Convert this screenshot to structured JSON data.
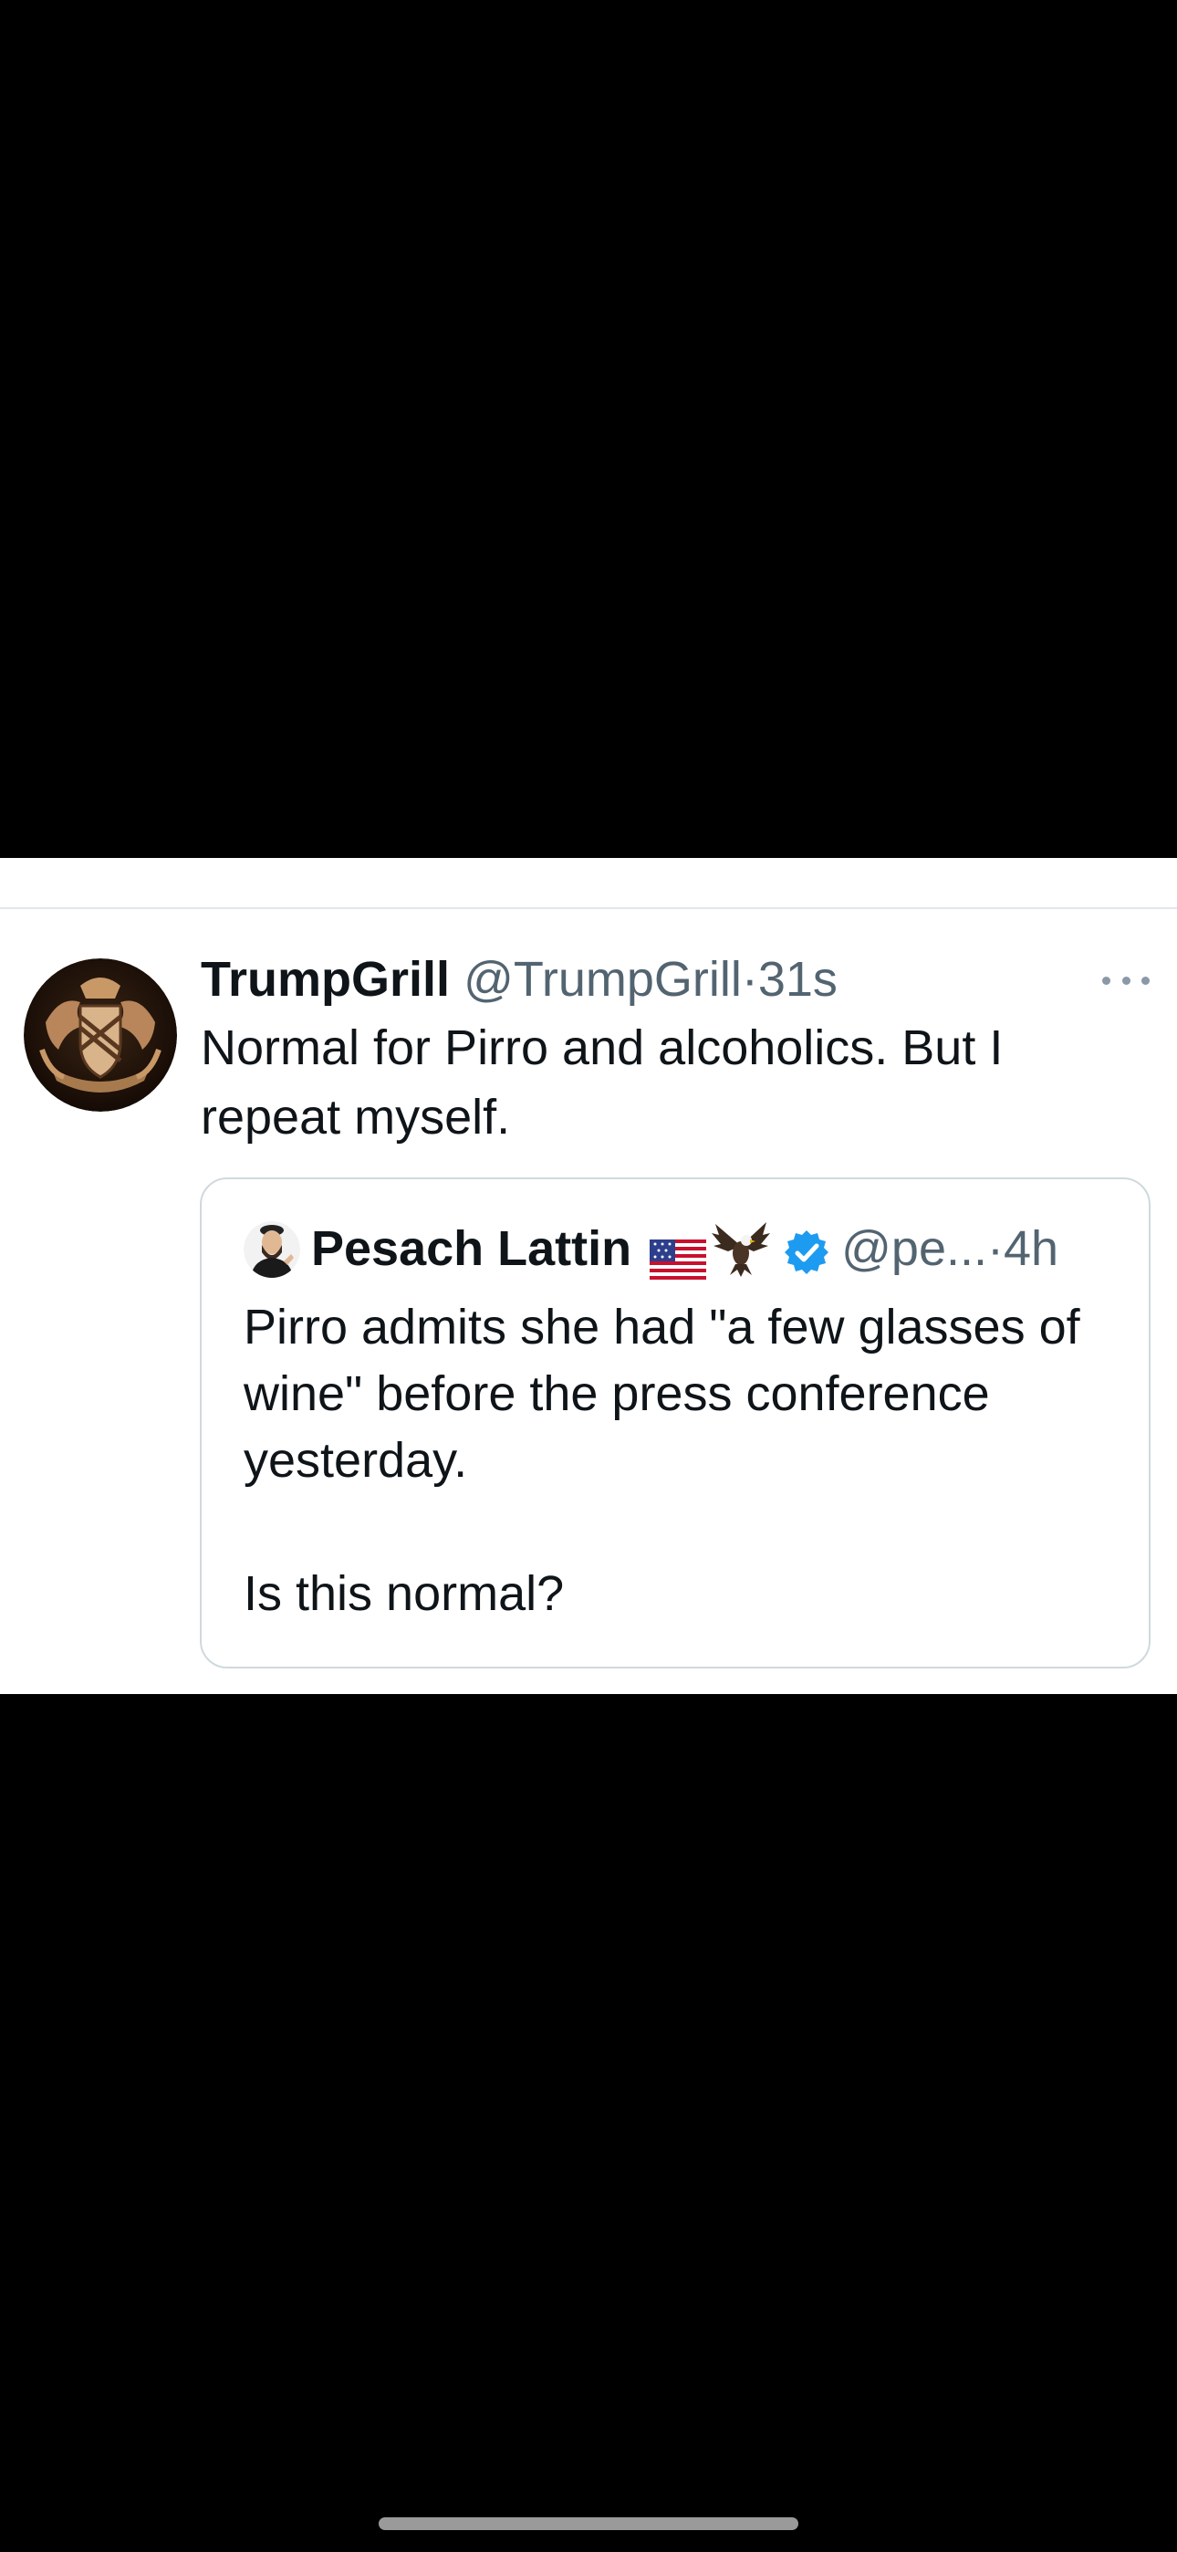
{
  "tweet": {
    "author_name": "TrumpGrill",
    "author_handle": "@TrumpGrill",
    "separator": "·",
    "timestamp": "31s",
    "text": "Normal for Pirro and alcoholics. But I repeat myself.",
    "more_icon": "more-horizontal-icon"
  },
  "quoted_tweet": {
    "author_name": "Pesach Lattin",
    "emoji_flag": "us-flag-icon",
    "emoji_eagle": "eagle-icon",
    "verified_icon": "verified-badge-icon",
    "author_handle": "@pe...",
    "separator": "·",
    "timestamp": "4h",
    "text_paragraphs": [
      "Pirro admits she had \"a few glasses of wine\" before the press conference yesterday.",
      "Is this normal?"
    ]
  },
  "colors": {
    "background": "#000000",
    "card": "#ffffff",
    "text_primary": "#0f1419",
    "text_secondary": "#536471",
    "verified_blue": "#1d9bf0",
    "border": "#cfd9de"
  }
}
